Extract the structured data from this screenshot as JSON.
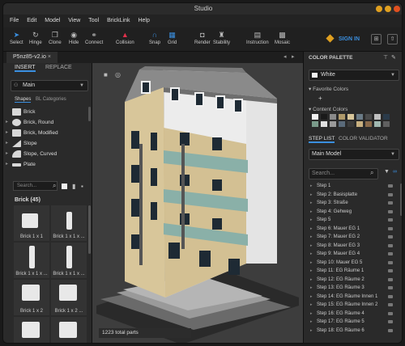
{
  "app": {
    "title": "Studio"
  },
  "menu": [
    "File",
    "Edit",
    "Model",
    "View",
    "Tool",
    "BrickLink",
    "Help"
  ],
  "toolbar": [
    {
      "icon": "arrow-cursor-icon",
      "label": "Select"
    },
    {
      "icon": "hinge-icon",
      "label": "Hinge"
    },
    {
      "icon": "clone-icon",
      "label": "Clone"
    },
    {
      "icon": "eye-icon",
      "label": "Hide"
    },
    {
      "icon": "connect-icon",
      "label": "Connect"
    },
    {
      "icon": "collision-icon",
      "label": "Collision"
    },
    {
      "icon": "magnet-icon",
      "label": "Snap"
    },
    {
      "icon": "grid-icon",
      "label": "Grid"
    },
    {
      "icon": "camera-icon",
      "label": "Render"
    },
    {
      "icon": "stability-icon",
      "label": "Stability"
    },
    {
      "icon": "instruction-icon",
      "label": "Instruction"
    },
    {
      "icon": "mosaic-icon",
      "label": "Mosaic"
    }
  ],
  "signin": "SIGN IN",
  "file_tab": "P5nz85-v2.io",
  "left": {
    "tabs": [
      "INSERT",
      "REPLACE"
    ],
    "palette_dropdown": "Main",
    "subtabs": [
      "Shapes",
      "BL Categories"
    ],
    "shapes": [
      "Brick",
      "Brick, Round",
      "Brick, Modified",
      "Slope",
      "Slope, Curved",
      "Plate"
    ],
    "search_placeholder": "Search...",
    "count_label": "Brick (45)",
    "tiles": [
      "Brick 1 x 1",
      "Brick 1 x 1 x ...",
      "Brick 1 x 1 x ...",
      "Brick 1 x 1 x ...",
      "Brick 1 x 2",
      "Brick 1 x 2 ..."
    ]
  },
  "viewport": {
    "parts_label": "1223 total parts"
  },
  "right": {
    "color_palette_title": "COLOR PALETTE",
    "selected_color": "White",
    "favorite_colors": "Favorite Colors",
    "content_colors": "Content Colors",
    "tabs": [
      "STEP LIST",
      "COLOR VALIDATOR"
    ],
    "model_dropdown": "Main Model",
    "search_placeholder": "Search...",
    "steps": [
      "Step 1",
      "Step 2: Basisplatte",
      "Step 3: Straße",
      "Step 4: Gehweg",
      "Step 5",
      "Step 6: Mauer EG 1",
      "Step 7: Mauer EG 2",
      "Step 8: Mauer EG 3",
      "Step 9: Mauer EG 4",
      "Step 10: Mauer EG 5",
      "Step 11: EG Räume 1",
      "Step 12: EG Räume 2",
      "Step 13: EG Räume 3",
      "Step 14: EG Räume Innen 1",
      "Step 15: EG Räume Innen 2",
      "Step 16: EG Räume 4",
      "Step 17: EG Räume 5",
      "Step 18: EG Räume 6"
    ]
  },
  "colors": {
    "accent": "#3a8fe0",
    "content": [
      "#f2f2f2",
      "#1a1a1a",
      "#8a8a8a",
      "#b09a6a",
      "#d8c69a",
      "#6a7a86",
      "#4a4a4a",
      "#c0c0c0",
      "#2a3a4a",
      "#7a9a8a",
      "#e0e0e0",
      "#9a9a9a",
      "#5a6a7a",
      "#3a3a3a",
      "#c8b080",
      "#8a6a4a",
      "#a0b8b0",
      "#606060"
    ]
  }
}
